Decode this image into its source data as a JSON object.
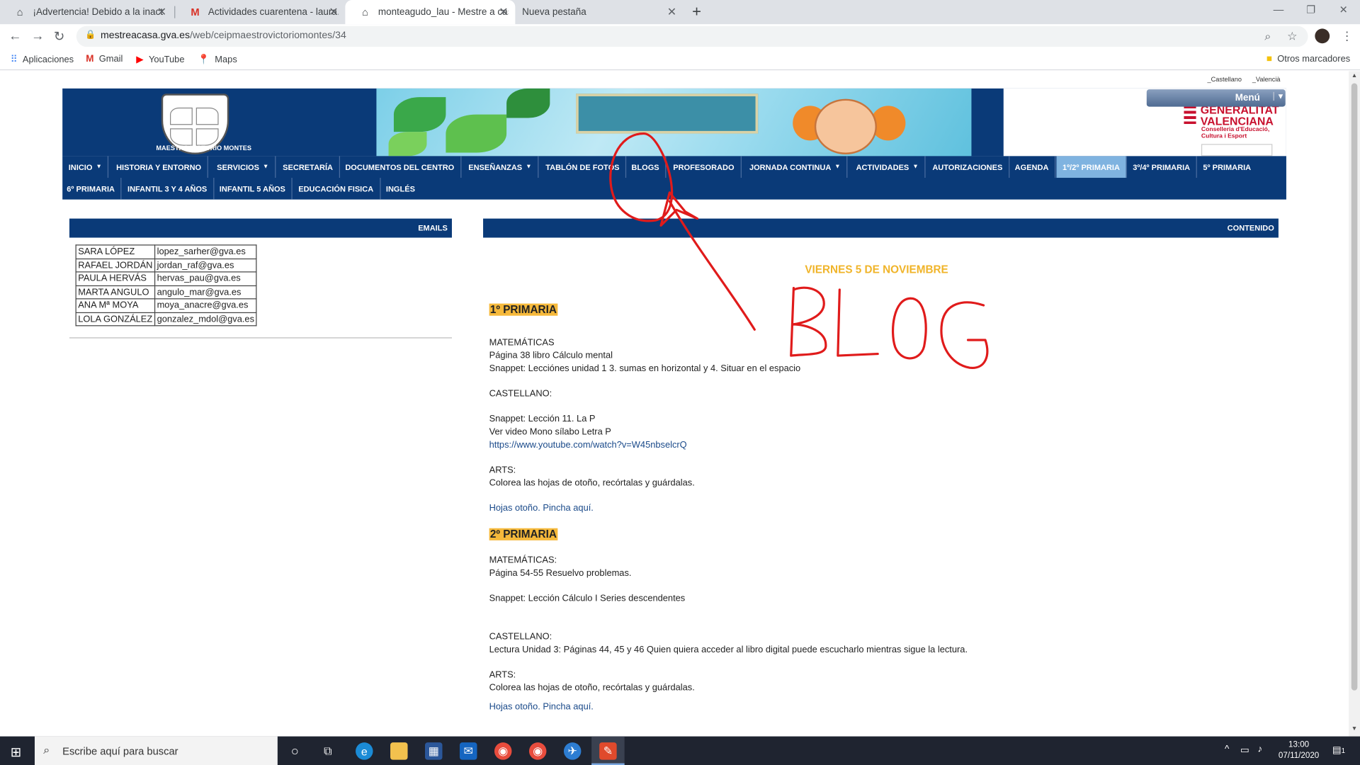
{
  "browser": {
    "tabs": [
      {
        "title": "¡Advertencia! Debido a la inactivi",
        "icon": "moodle-icon"
      },
      {
        "title": "Actividades cuarentena - laura.m",
        "icon": "gmail-icon"
      },
      {
        "title": "monteagudo_lau - Mestre a casa",
        "icon": "moodle-icon"
      },
      {
        "title": "Nueva pestaña",
        "icon": ""
      }
    ],
    "url_host": "mestreacasa.gva.es",
    "url_path": "/web/ceipmaestrovictoriomontes/34",
    "bookmarks": [
      {
        "label": "Aplicaciones",
        "icon": "apps-grid-icon"
      },
      {
        "label": "Gmail",
        "icon": "gmail-icon"
      },
      {
        "label": "YouTube",
        "icon": "youtube-icon"
      },
      {
        "label": "Maps",
        "icon": "maps-pin-icon"
      }
    ],
    "other_bookmarks": "Otros marcadores"
  },
  "site": {
    "lang_es": "_Castellano",
    "lang_va": "_Valencià",
    "logo_text": "MAESTRO VICTORIO MONTES",
    "gva_title_1": "GENERALITAT",
    "gva_title_2": "VALENCIANA",
    "gva_sub": "Conselleria d'Educació, Cultura i Esport",
    "menu_label": "Menú",
    "nav_row1": [
      {
        "label": "INICIO",
        "dropdown": true
      },
      {
        "label": "HISTORIA Y ENTORNO",
        "dropdown": false
      },
      {
        "label": "SERVICIOS",
        "dropdown": true
      },
      {
        "label": "SECRETARÍA",
        "dropdown": false
      },
      {
        "label": "DOCUMENTOS DEL CENTRO",
        "dropdown": false
      },
      {
        "label": "ENSEÑANZAS",
        "dropdown": true
      },
      {
        "label": "TABLÓN DE FOTOS",
        "dropdown": false
      },
      {
        "label": "BLOGS",
        "dropdown": false
      },
      {
        "label": "PROFESORADO",
        "dropdown": false
      },
      {
        "label": "JORNADA CONTINUA",
        "dropdown": true
      },
      {
        "label": "ACTIVIDADES",
        "dropdown": true
      },
      {
        "label": "AUTORIZACIONES",
        "dropdown": false
      },
      {
        "label": "AGENDA",
        "dropdown": false
      },
      {
        "label": "1º/2º PRIMARIA",
        "dropdown": false,
        "active": true
      },
      {
        "label": "3º/4º PRIMARIA",
        "dropdown": false
      },
      {
        "label": "5º PRIMARIA",
        "dropdown": false
      }
    ],
    "nav_row2": [
      {
        "label": "6º PRIMARIA"
      },
      {
        "label": "INFANTIL 3 Y 4 AÑOS"
      },
      {
        "label": "INFANTIL 5 AÑOS"
      },
      {
        "label": "EDUCACIÓN FISICA"
      },
      {
        "label": "INGLÉS"
      }
    ]
  },
  "emails": {
    "header": "EMAILS",
    "rows": [
      {
        "name": "SARA LÓPEZ",
        "email": "lopez_sarher@gva.es"
      },
      {
        "name": "RAFAEL JORDÁN",
        "email": "jordan_raf@gva.es"
      },
      {
        "name": "PAULA HERVÁS",
        "email": "hervas_pau@gva.es"
      },
      {
        "name": "MARTA ANGULO",
        "email": "angulo_mar@gva.es"
      },
      {
        "name": "ANA Mª MOYA",
        "email": "moya_anacre@gva.es"
      },
      {
        "name": "LOLA GONZÁLEZ",
        "email": "gonzalez_mdol@gva.es"
      }
    ]
  },
  "content": {
    "header": "CONTENIDO",
    "date": "VIERNES 5 DE NOVIEMBRE",
    "h1": "1º PRIMARIA",
    "p1_mat": "MATEMÁTICAS",
    "p1_mat_1": " Página 38 libro Cálculo mental",
    "p1_mat_2": "Snappet: Lecciónes unidad 1 3. sumas en horizontal y 4. Situar en el espacio",
    "p1_cas": "CASTELLANO:",
    "p1_cas_1": "Snappet: Lección 11. La P",
    "p1_cas_2": "Ver video Mono sílabo Letra P",
    "p1_cas_link": "https://www.youtube.com/watch?v=W45nbselcrQ",
    "p1_arts": "ARTS:",
    "p1_arts_1": "Colorea las hojas de otoño, recórtalas y guárdalas.",
    "p1_arts_link": "Hojas otoño. Pincha aquí.",
    "h2": "2º PRIMARIA",
    "p2_mat": "MATEMÁTICAS:",
    "p2_mat_1": "Página 54-55 Resuelvo problemas.",
    "p2_mat_2": "Snappet: Lección Cálculo I Series descendentes",
    "p2_cas": "CASTELLANO:",
    "p2_cas_1": "Lectura Unidad 3: Páginas 44, 45 y 46 Quien quiera acceder al libro digital puede escucharlo mientras sigue la lectura.",
    "p2_arts": "ARTS:",
    "p2_arts_1": "Colorea las hojas de otoño, recórtalas y guárdalas.",
    "p2_arts_link": "Hojas otoño. Pincha aquí."
  },
  "annotation": {
    "text": "BLOG",
    "color": "#e01b1b"
  },
  "taskbar": {
    "search_placeholder": "Escribe aquí para buscar",
    "time": "13:00",
    "date": "07/11/2020",
    "notification_count": "1"
  },
  "colors": {
    "site_navy": "#0a3a78",
    "active_nav": "#7fb3e0",
    "highlight": "#f6b93b",
    "date_gold": "#f0b429"
  }
}
